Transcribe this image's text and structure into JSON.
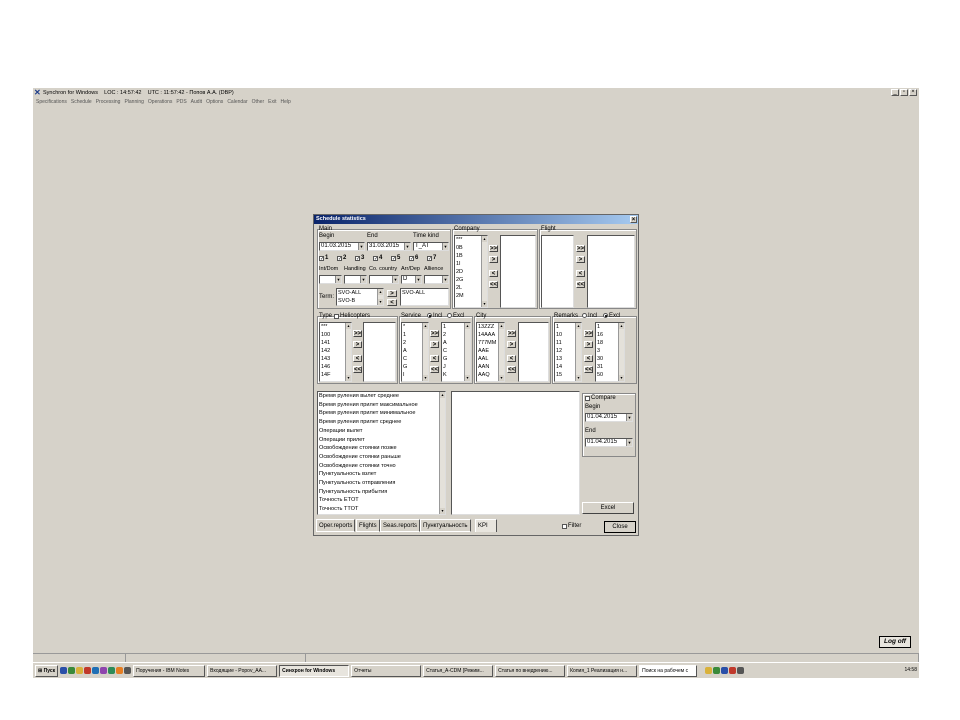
{
  "app": {
    "title": "Synchron for Windows",
    "loc_time": "LOC : 14:57:42",
    "utc_time": "UTC : 11:57:42 - Попов А.А. (DBP)",
    "menu": [
      "Specifications",
      "Schedule",
      "Processing",
      "Planning",
      "Operations",
      "PDS",
      "Audit",
      "Options",
      "Calendar",
      "Other",
      "Exit",
      "Help"
    ],
    "logoff_label": "Log off"
  },
  "dialog": {
    "title": "Schedule statistics",
    "main": {
      "group_label": "Main",
      "begin_label": "Begin",
      "begin_value": "01.03.2015",
      "end_label": "End",
      "end_value": "31.03.2015",
      "timekind_label": "Time kind",
      "timekind_value": "T_AT",
      "days": [
        "1",
        "2",
        "3",
        "4",
        "5",
        "6",
        "7"
      ],
      "filters": [
        "Int/Dom",
        "Handling",
        "Co. country",
        "Arr/Dep",
        "Allience"
      ],
      "arrdep_value": "D",
      "term_label": "Term:",
      "term_list": [
        "SVO-ALL",
        "SVO-B"
      ],
      "term_selected": "SVO-ALL"
    },
    "company": {
      "label": "Company",
      "items": [
        "***",
        "0B",
        "1B",
        "1I",
        "2D",
        "2G",
        "2L",
        "2M"
      ]
    },
    "flight": {
      "label": "Flight"
    },
    "type": {
      "label": "Type",
      "helicopters_label": "Helicopters",
      "items": [
        "***",
        "100",
        "141",
        "142",
        "143",
        "146",
        "14F"
      ]
    },
    "service": {
      "label": "Service",
      "incl_label": "Incl",
      "excl_label": "Excl",
      "items": [
        "*",
        "1",
        "2",
        "A",
        "C",
        "G",
        "I"
      ],
      "selected": [
        "1",
        "2",
        "A",
        "C",
        "G",
        "J",
        "K"
      ]
    },
    "city": {
      "label": "City",
      "items": [
        "13ZZZ",
        "14AAA",
        "777MM",
        "AAE",
        "AAL",
        "AAN",
        "AAQ"
      ]
    },
    "remarks": {
      "label": "Remarks",
      "incl_label": "Incl",
      "excl_label": "Excl",
      "items": [
        "1",
        "10",
        "11",
        "12",
        "13",
        "14",
        "15"
      ],
      "selected": [
        "1",
        "16",
        "18",
        "3",
        "30",
        "31",
        "50"
      ]
    },
    "reports": [
      "Время руления вылет среднее",
      "Время руления прилет максимальное",
      "Время руления прилет минимальное",
      "Время руления прилет среднее",
      "Операции вылет",
      "Операции прилет",
      "Освобождение стоянки позже",
      "Освобождение стоянки раньше",
      "Освобождение стоянки точно",
      "Пунктуальность взлет",
      "Пунктуальность отправления",
      "Пунктуальность прибытия",
      "Точность ETOT",
      "Точность TTOT"
    ],
    "compare": {
      "label": "Compare",
      "begin_label": "Begin",
      "begin_value": "01.04.2015",
      "end_label": "End",
      "end_value": "01.04.2015"
    },
    "excel_label": "Excel",
    "tabs": [
      "Oper.reports",
      "Flights",
      "Seas.reports",
      "Пунктуальность",
      "KPI"
    ],
    "filter_label": "Filter",
    "close_label": "Close",
    "buttons": {
      "add_all": ">>",
      "add": ">",
      "remove": "<",
      "remove_all": "<<"
    }
  },
  "taskbar": {
    "start_label": "Пуск",
    "items": [
      "Поручения - IBM Notes",
      "Входящие - Popov_AA...",
      "Синхрон for Windows",
      "Отчеты",
      "Статья_A-CDM [Режим...",
      "Статья по внедрению...",
      "Копия_1 Реализация н..."
    ],
    "active_index": 2,
    "search_placeholder": "Поиск на рабочем с",
    "clock": "14:58"
  },
  "colors": {
    "title_start": "#0a246a",
    "title_end": "#a6caf0",
    "face": "#d6d2c9"
  }
}
